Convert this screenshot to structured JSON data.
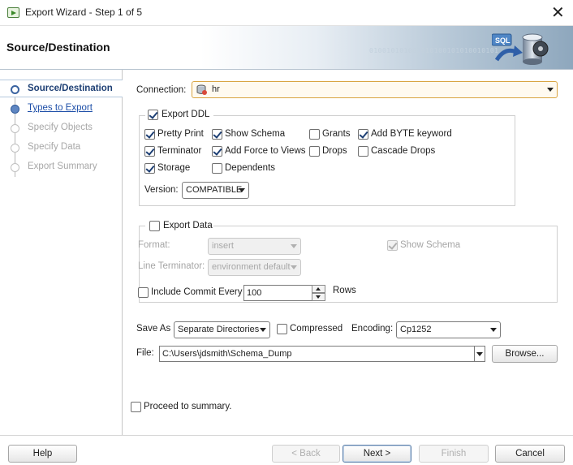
{
  "window": {
    "title": "Export Wizard - Step 1 of 5",
    "close_glyph": "✕"
  },
  "banner": {
    "heading": "Source/Destination",
    "binary_text": "010010101001010100101010010101",
    "logo_text": "SQL"
  },
  "steps": [
    {
      "label": "Source/Destination",
      "state": "active"
    },
    {
      "label": "Types to Export",
      "state": "link"
    },
    {
      "label": "Specify Objects",
      "state": "disabled"
    },
    {
      "label": "Specify Data",
      "state": "disabled"
    },
    {
      "label": "Export Summary",
      "state": "disabled"
    }
  ],
  "connection": {
    "label": "Connection:",
    "value": "hr"
  },
  "export_ddl": {
    "label": "Export DDL",
    "checked": true,
    "options": {
      "pretty_print": {
        "label": "Pretty Print",
        "checked": true
      },
      "show_schema": {
        "label": "Show Schema",
        "checked": true
      },
      "grants": {
        "label": "Grants",
        "checked": false
      },
      "add_byte_keyword": {
        "label": "Add BYTE keyword",
        "checked": true
      },
      "terminator": {
        "label": "Terminator",
        "checked": true
      },
      "add_force_to_views": {
        "label": "Add Force to Views",
        "checked": true
      },
      "drops": {
        "label": "Drops",
        "checked": false
      },
      "cascade_drops": {
        "label": "Cascade Drops",
        "checked": false
      },
      "storage": {
        "label": "Storage",
        "checked": true
      },
      "dependents": {
        "label": "Dependents",
        "checked": false
      }
    },
    "version_label": "Version:",
    "version_value": "COMPATIBLE"
  },
  "export_data": {
    "label": "Export Data",
    "checked": false,
    "format_label": "Format:",
    "format_value": "insert",
    "show_schema_label": "Show Schema",
    "show_schema_checked": true,
    "line_terminator_label": "Line Terminator:",
    "line_terminator_value": "environment default",
    "include_commit_label": "Include Commit Every",
    "include_commit_checked": false,
    "commit_value": "100",
    "rows_label": "Rows"
  },
  "save_as": {
    "label": "Save As",
    "value": "Separate Directories"
  },
  "compressed": {
    "label": "Compressed",
    "checked": false
  },
  "encoding": {
    "label": "Encoding:",
    "value": "Cp1252"
  },
  "file": {
    "label": "File:",
    "value": "C:\\Users\\jdsmith\\Schema_Dump",
    "browse_label": "Browse..."
  },
  "proceed": {
    "label": "Proceed to summary.",
    "checked": false
  },
  "footer": {
    "help_label": "Help",
    "back_label": "< Back",
    "next_label": "Next >",
    "finish_label": "Finish",
    "cancel_label": "Cancel"
  },
  "colors": {
    "accent": "#1d3f74",
    "link": "#1e4fa8",
    "connection_border": "#d9a441"
  },
  "icons": {
    "database": "database-icon",
    "app": "wizard-app-icon"
  }
}
